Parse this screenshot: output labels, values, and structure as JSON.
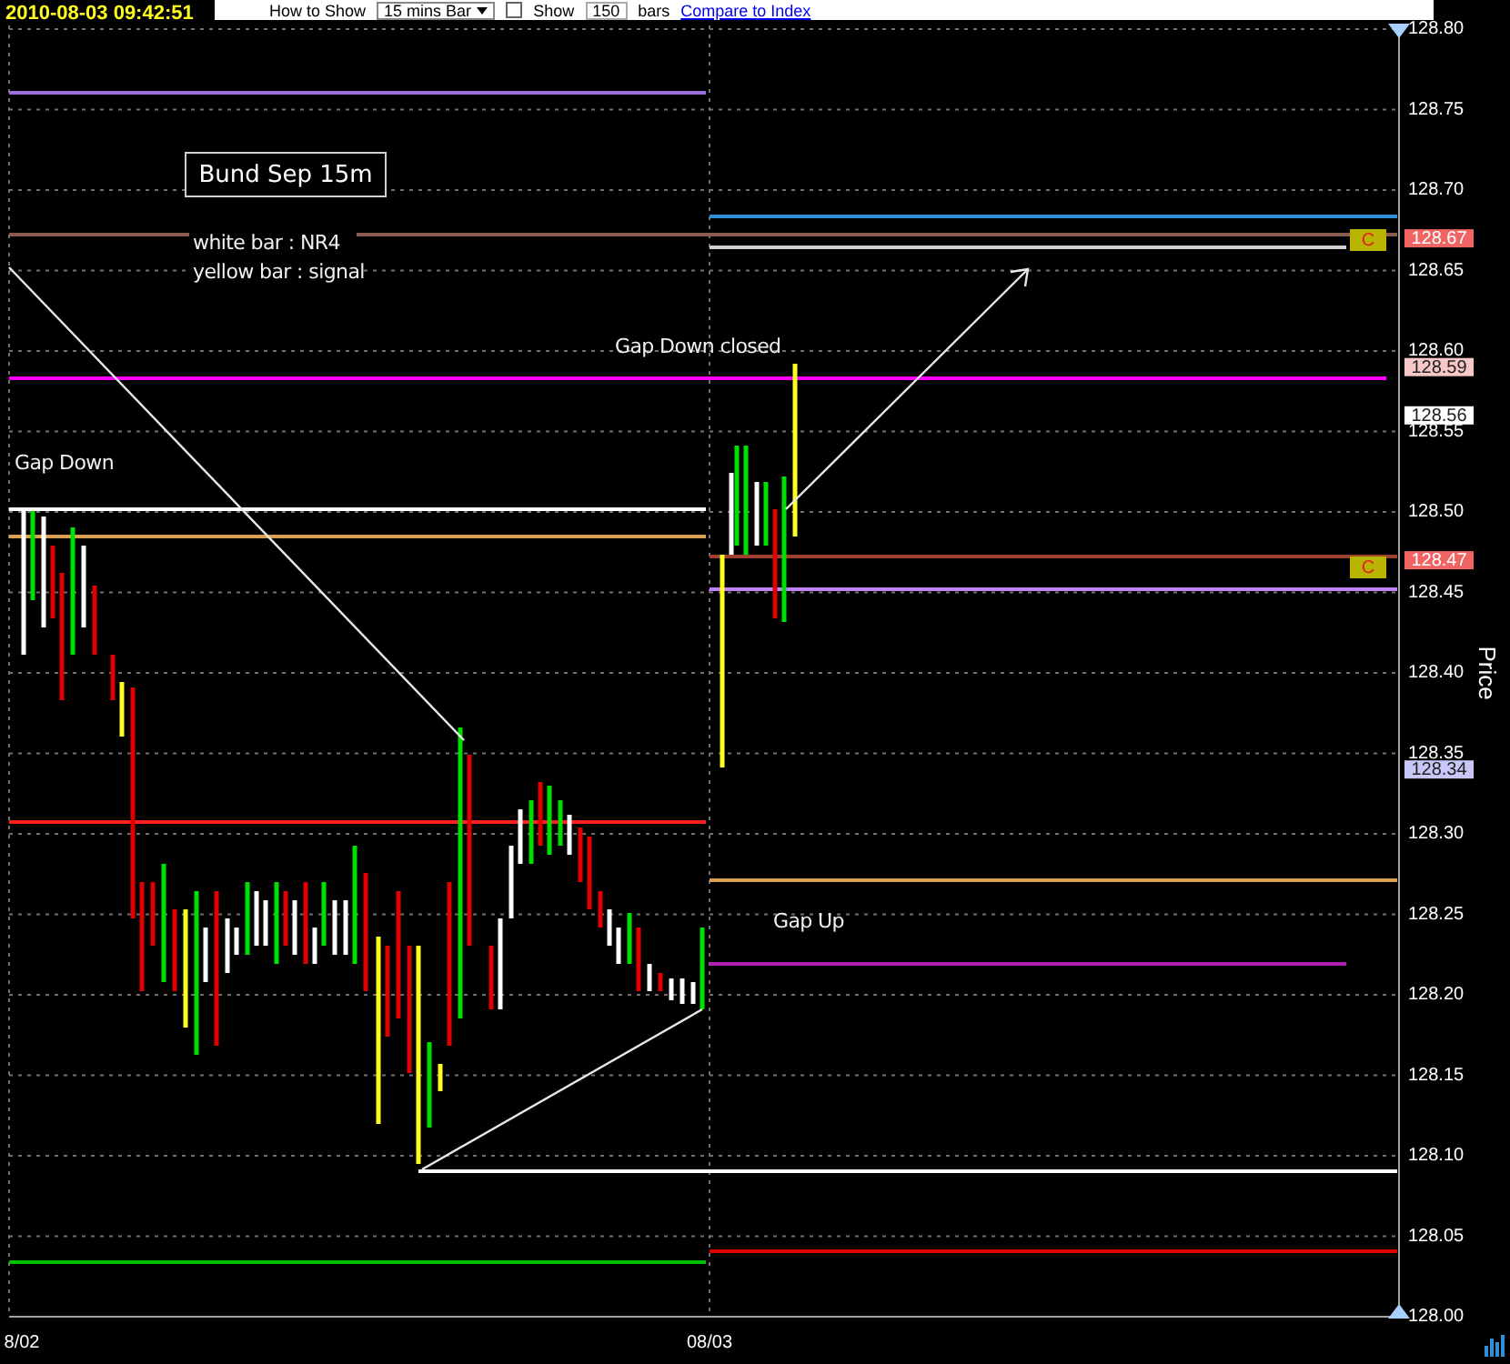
{
  "header": {
    "timestamp": "2010-08-03 09:42:51"
  },
  "toolbar": {
    "how_to_show": "How to Show",
    "interval": "15 mins Bar",
    "show": {
      "label": "Show",
      "checked": false
    },
    "bar_count": "150",
    "bars_label": "bars",
    "compare_link": "Compare to Index"
  },
  "chart": {
    "title": "Bund Sep 15m",
    "legend": [
      "white bar : NR4",
      "yellow bar : signal"
    ],
    "chart_data": {
      "type": "line",
      "ylabel": "Price",
      "ylim": [
        128.0,
        128.8
      ],
      "yticks": [
        {
          "value": 128.0,
          "label": "128.00"
        },
        {
          "value": 128.05,
          "label": "128.05"
        },
        {
          "value": 128.1,
          "label": "128.10"
        },
        {
          "value": 128.15,
          "label": "128.15"
        },
        {
          "value": 128.2,
          "label": "128.20"
        },
        {
          "value": 128.25,
          "label": "128.25"
        },
        {
          "value": 128.3,
          "label": "128.30"
        },
        {
          "value": 128.35,
          "label": "128.35"
        },
        {
          "value": 128.4,
          "label": "128.40"
        },
        {
          "value": 128.45,
          "label": "128.45"
        },
        {
          "value": 128.5,
          "label": "128.50"
        },
        {
          "value": 128.55,
          "label": "128.55"
        },
        {
          "value": 128.6,
          "label": "128.60"
        },
        {
          "value": 128.65,
          "label": "128.65"
        },
        {
          "value": 128.7,
          "label": "128.70"
        },
        {
          "value": 128.75,
          "label": "128.75"
        },
        {
          "value": 128.8,
          "label": "128.80"
        }
      ],
      "categories": [
        "8/02",
        "08/03"
      ],
      "grid": true,
      "annotations": [
        "Gap Down",
        "Gap Down closed",
        "Gap Up"
      ]
    },
    "level_lines": [
      {
        "color": "#9a70d8"
      },
      {
        "color": "#8b5a50"
      },
      {
        "color": "#2e8ed8"
      },
      {
        "color": "#d0d0d0"
      },
      {
        "color": "#ff00ff"
      },
      {
        "color": "#ffffff"
      },
      {
        "color": "#d8a050"
      },
      {
        "color": "#a04030"
      },
      {
        "color": "#c080ff"
      },
      {
        "color": "#ff2020"
      },
      {
        "color": "#d8a050"
      },
      {
        "color": "#b020b0"
      },
      {
        "color": "#ffffff"
      },
      {
        "color": "#00c000"
      },
      {
        "color": "#e00000"
      }
    ],
    "markers": [
      {
        "text": "C"
      },
      {
        "text": "C"
      }
    ],
    "price_tags": [
      {
        "text": "128.67",
        "color": "#f06464"
      },
      {
        "text": "128.59",
        "color": "#f8c8c8"
      },
      {
        "text": "128.56",
        "color": "#ffffff"
      },
      {
        "text": "128.47",
        "color": "#f06464"
      },
      {
        "text": "128.34",
        "color": "#c8c8f8"
      }
    ]
  }
}
